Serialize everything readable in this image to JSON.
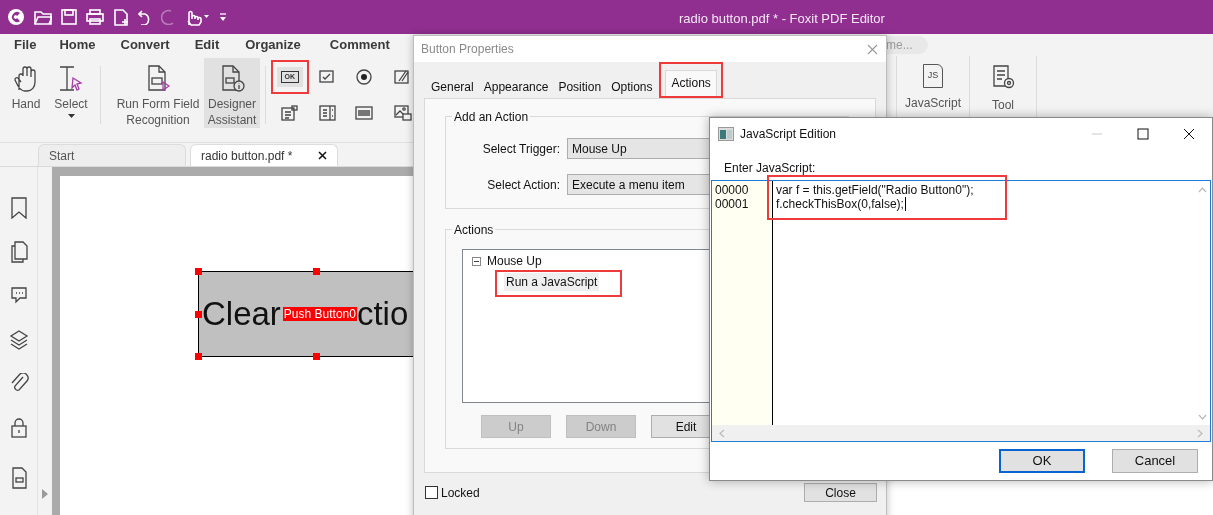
{
  "app": {
    "title": "radio button.pdf * - Foxit PDF Editor"
  },
  "menu": [
    {
      "label": "File"
    },
    {
      "label": "Home"
    },
    {
      "label": "Convert"
    },
    {
      "label": "Edit"
    },
    {
      "label": "Organize"
    },
    {
      "label": "Comment"
    }
  ],
  "search": {
    "placeholder": "me..."
  },
  "ribbon": {
    "tools": [
      {
        "kind": "hand",
        "label": "Hand",
        "dropdown": false,
        "selected": false
      },
      {
        "kind": "select",
        "label": "Select",
        "dropdown": true,
        "selected": false
      },
      {
        "kind": "recognition",
        "label": "Run Form Field Recognition",
        "dropdown": false,
        "selected": false
      },
      {
        "kind": "assistant",
        "label": "Designer Assistant",
        "dropdown": false,
        "selected": true
      }
    ],
    "form_tools": [
      {
        "kind": "push-button",
        "icon_text": "OK",
        "highlighted": true
      },
      {
        "kind": "checkbox",
        "highlighted": false
      },
      {
        "kind": "radio",
        "highlighted": false
      },
      {
        "kind": "pen",
        "highlighted": false
      },
      {
        "kind": "combo",
        "highlighted": false
      },
      {
        "kind": "list",
        "highlighted": false
      },
      {
        "kind": "barcode",
        "highlighted": false
      },
      {
        "kind": "image",
        "highlighted": false
      }
    ],
    "right_tools": [
      {
        "kind": "javascript",
        "icon_text": "JS",
        "label": "JavaScript"
      },
      {
        "kind": "settings",
        "label": "Tool"
      }
    ]
  },
  "tabs": [
    {
      "label": "Start",
      "selected": false,
      "closable": false
    },
    {
      "label": "radio button.pdf *",
      "selected": true,
      "closable": true
    }
  ],
  "sidebar": [
    {
      "kind": "bookmark"
    },
    {
      "kind": "pages"
    },
    {
      "kind": "comments"
    },
    {
      "kind": "layers"
    },
    {
      "kind": "attachments"
    },
    {
      "kind": "security"
    },
    {
      "kind": "form"
    }
  ],
  "document": {
    "field": {
      "text_before": "Clear",
      "name_tag": "Push Button0",
      "text_after": "ctio",
      "selected": true
    }
  },
  "button_properties": {
    "title": "Button Properties",
    "tabs": [
      {
        "label": "General",
        "selected": false,
        "highlighted": false
      },
      {
        "label": "Appearance",
        "selected": false,
        "highlighted": false
      },
      {
        "label": "Position",
        "selected": false,
        "highlighted": false
      },
      {
        "label": "Options",
        "selected": false,
        "highlighted": false
      },
      {
        "label": "Actions",
        "selected": true,
        "highlighted": true
      }
    ],
    "add_action": {
      "legend": "Add an Action",
      "trigger_label": "Select Trigger:",
      "trigger_value": "Mouse Up",
      "action_label": "Select Action:",
      "action_value": "Execute a menu item"
    },
    "actions": {
      "legend": "Actions",
      "tree": [
        {
          "label": "Mouse Up",
          "expanded": true,
          "children": [
            {
              "label": "Run a JavaScript",
              "selected": true,
              "highlighted": true
            }
          ]
        }
      ],
      "buttons": [
        {
          "label": "Up",
          "disabled": true
        },
        {
          "label": "Down",
          "disabled": true
        },
        {
          "label": "Edit",
          "disabled": false
        }
      ]
    },
    "locked": {
      "label": "Locked",
      "checked": false
    },
    "close": "Close"
  },
  "js_editor": {
    "title": "JavaScript Edition",
    "prompt": "Enter JavaScript:",
    "code_highlighted": true,
    "lines": [
      {
        "number": "00000",
        "code": "var f = this.getField(\"Radio Button0\");"
      },
      {
        "number": "00001",
        "code": "f.checkThisBox(0,false);"
      }
    ],
    "buttons": [
      {
        "label": "OK",
        "default": true
      },
      {
        "label": "Cancel",
        "default": false
      }
    ]
  }
}
